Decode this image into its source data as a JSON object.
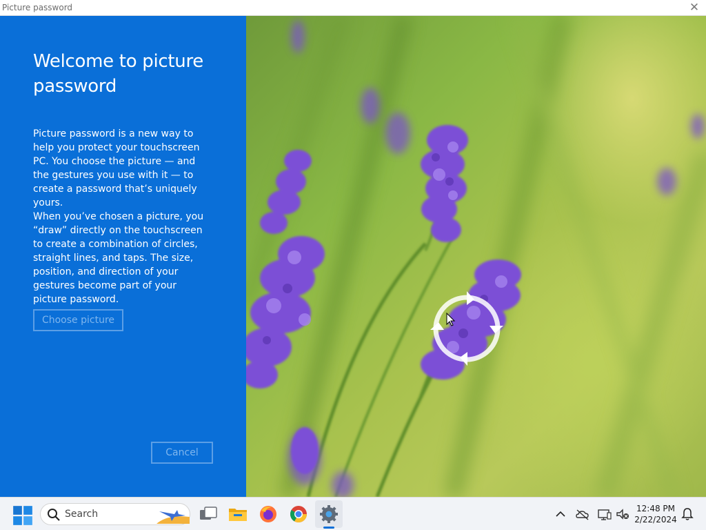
{
  "window": {
    "title": "Picture password",
    "close_glyph": "✕"
  },
  "panel": {
    "heading": "Welcome to picture password",
    "paragraph1": "Picture password is a new way to help you protect your touchscreen PC. You choose the picture — and the gestures you use with it — to create a password that’s uniquely yours.",
    "paragraph2": "When you’ve chosen a picture, you “draw” directly on the touchscreen to create a combination of circles, straight lines, and taps. The size, position, and direction of your gestures become part of your picture password.",
    "choose_label": "Choose picture",
    "cancel_label": "Cancel"
  },
  "picture": {
    "subject": "lavender-flowers",
    "gesture_icon": "rotate-circle-icon"
  },
  "taskbar": {
    "search_label": "Search",
    "apps": [
      "start-icon",
      "task-view-icon",
      "file-explorer-icon",
      "firefox-icon",
      "chrome-icon",
      "settings-icon"
    ],
    "active_app": "settings-icon",
    "tray_icons": [
      "chevron-up-icon",
      "onedrive-icon",
      "network-icon",
      "volume-muted-icon",
      "notification-bell-icon"
    ],
    "time": "12:48 PM",
    "date": "2/22/2024"
  },
  "colors": {
    "panel_blue": "#0a6fd8",
    "button_border": "#5c9fe6",
    "taskbar": "#f1f3f7"
  }
}
